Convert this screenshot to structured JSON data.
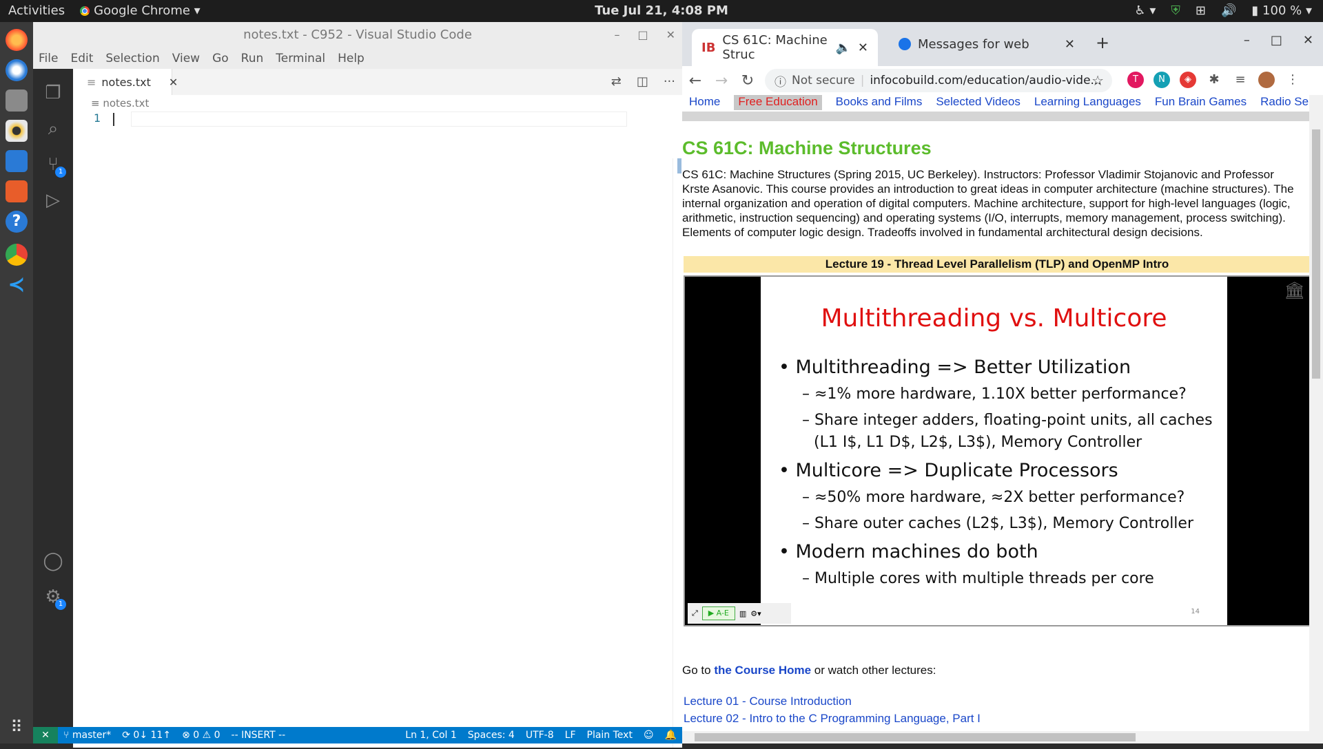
{
  "topbar": {
    "activities": "Activities",
    "app_name": "Google Chrome",
    "clock": "Tue Jul 21,  4:08 PM",
    "battery": "100 %"
  },
  "vscode": {
    "window_title": "notes.txt - C952 - Visual Studio Code",
    "menu": [
      "File",
      "Edit",
      "Selection",
      "View",
      "Go",
      "Run",
      "Terminal",
      "Help"
    ],
    "tab_label": "notes.txt",
    "breadcrumb": "notes.txt",
    "line_number": "1",
    "scm_badge": "1",
    "settings_badge": "1",
    "status": {
      "branch": "master*",
      "sync": "0↓ 11↑",
      "problems": "0 ⚠ 0",
      "mode": "-- INSERT --",
      "position": "Ln 1, Col 1",
      "spaces": "Spaces: 4",
      "encoding": "UTF-8",
      "eol": "LF",
      "language": "Plain Text"
    }
  },
  "chrome": {
    "tabs": [
      {
        "title": "CS 61C: Machine Struc",
        "active": true
      },
      {
        "title": "Messages for web",
        "active": false
      }
    ],
    "security": "Not secure",
    "url": "infocobuild.com/education/audio-vide..."
  },
  "page": {
    "nav": [
      {
        "label": "Home",
        "active": false
      },
      {
        "label": "Free Education",
        "active": true
      },
      {
        "label": "Books and Films",
        "active": false
      },
      {
        "label": "Selected Videos",
        "active": false
      },
      {
        "label": "Learning Languages",
        "active": false
      },
      {
        "label": "Fun Brain Games",
        "active": false
      },
      {
        "label": "Radio Serv",
        "active": false
      }
    ],
    "title": "CS 61C: Machine Structures",
    "description": "CS 61C: Machine Structures (Spring 2015, UC Berkeley). Instructors: Professor Vladimir Stojanovic and Professor Krste Asanovic. This course provides an introduction to great ideas in computer architecture (machine structures). The internal organization and operation of digital computers. Machine architecture, support for high-level languages (logic, arithmetic, instruction sequencing) and operating systems (I/O, interrupts, memory management, process switching). Elements of computer logic design. Tradeoffs involved in fundamental architectural design decisions.",
    "lecture_title": "Lecture 19 - Thread Level Parallelism (TLP) and OpenMP Intro",
    "slide": {
      "title": "Multithreading vs. Multicore",
      "bullets": [
        "•  Multithreading => Better Utilization",
        "– ≈1% more hardware, 1.10X better performance?",
        "– Share integer adders, floating-point units, all caches",
        "(L1 I$, L1 D$, L2$, L3$), Memory Controller",
        "•  Multicore => Duplicate Processors",
        "– ≈50% more hardware, ≈2X better performance?",
        "– Share outer caches (L2$, L3$), Memory Controller",
        "•  Modern machines do both",
        "– Multiple cores with multiple threads per core"
      ],
      "page_number": "14"
    },
    "player_play_label": "▶ A-E",
    "goto_prefix": "Go to ",
    "goto_link": "the Course Home",
    "goto_suffix": " or watch other lectures:",
    "lectures": [
      "Lecture 01 - Course Introduction",
      "Lecture 02 - Intro to the C Programming Language, Part I"
    ]
  }
}
